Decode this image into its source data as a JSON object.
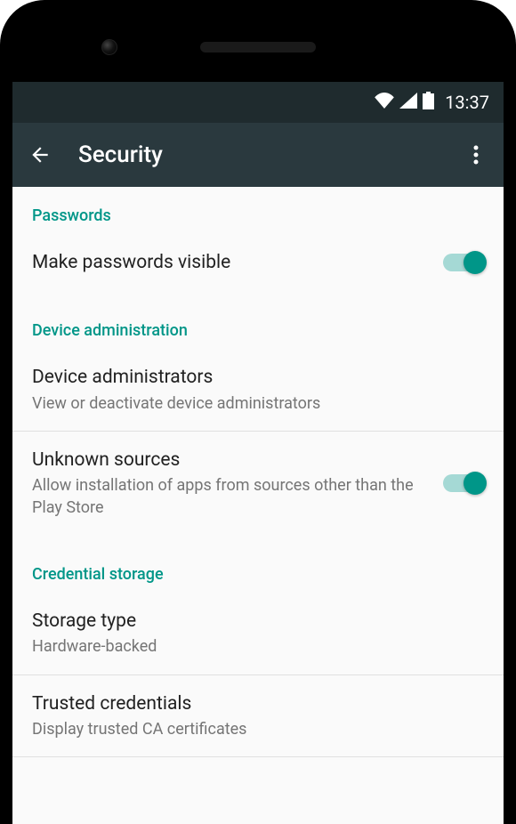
{
  "statusBar": {
    "time": "13:37"
  },
  "appBar": {
    "title": "Security"
  },
  "sections": {
    "passwords": {
      "header": "Passwords",
      "makeVisible": {
        "title": "Make passwords visible"
      }
    },
    "deviceAdmin": {
      "header": "Device administration",
      "administrators": {
        "title": "Device administrators",
        "subtitle": "View or deactivate device administrators"
      },
      "unknownSources": {
        "title": "Unknown sources",
        "subtitle": "Allow installation of apps from sources other than the Play Store"
      }
    },
    "credentialStorage": {
      "header": "Credential storage",
      "storageType": {
        "title": "Storage type",
        "subtitle": "Hardware-backed"
      },
      "trustedCredentials": {
        "title": "Trusted credentials",
        "subtitle": "Display trusted CA certificates"
      }
    }
  }
}
